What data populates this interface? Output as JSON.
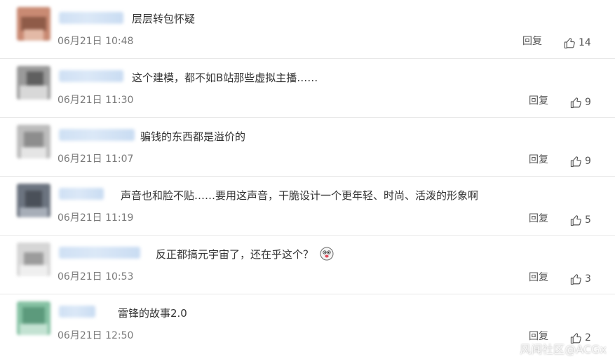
{
  "comments": [
    {
      "text": "层层转包怀疑",
      "time": "06月21日 10:48",
      "reply_label": "回复",
      "likes": "14",
      "avatar_colors": [
        "#c98a73",
        "#8f5b48",
        "#e3b9a6"
      ]
    },
    {
      "text": "这个建模，都不如B站那些虚拟主播……",
      "time": "06月21日 11:30",
      "reply_label": "回复",
      "likes": "9",
      "avatar_colors": [
        "#9a9a9a",
        "#5f5f5f",
        "#d8d8d8"
      ]
    },
    {
      "text": "骗钱的东西都是溢价的",
      "time": "06月21日 11:07",
      "reply_label": "回复",
      "likes": "9",
      "avatar_colors": [
        "#bdbdbd",
        "#8d8d8d",
        "#e5e5e5"
      ]
    },
    {
      "text": "声音也和脸不贴……要用这声音，干脆设计一个更年轻、时尚、活泼的形象啊",
      "time": "06月21日 11:19",
      "reply_label": "回复",
      "likes": "5",
      "avatar_colors": [
        "#6c7480",
        "#4a5059",
        "#a7aeb8"
      ]
    },
    {
      "text": "反正都搞元宇宙了，还在乎这个？",
      "time": "06月21日 10:53",
      "reply_label": "回复",
      "likes": "3",
      "emoji": "doge-emoji",
      "avatar_colors": [
        "#d6d6d6",
        "#9c9c9c",
        "#efefef"
      ]
    },
    {
      "text": "雷锋的故事2.0",
      "time": "06月21日 12:50",
      "reply_label": "回复",
      "likes": "2",
      "avatar_colors": [
        "#86c2a4",
        "#5c9a7c",
        "#c3e2d2"
      ]
    }
  ],
  "watermark": "风闻社区@ACGx"
}
